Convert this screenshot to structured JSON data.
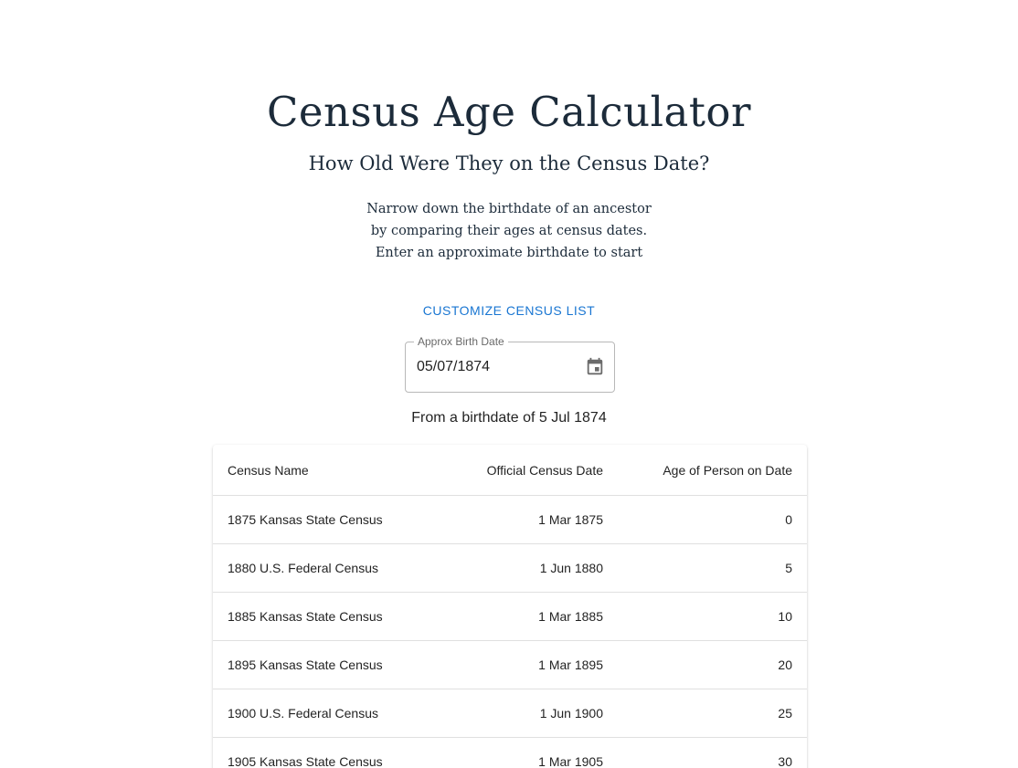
{
  "header": {
    "title": "Census Age Calculator",
    "subtitle": "How Old Were They on the Census Date?",
    "intro_lines": [
      "Narrow down the birthdate of an ancestor",
      "by comparing their ages at census dates.",
      "Enter an approximate birthdate to start"
    ]
  },
  "controls": {
    "customize_label": "CUSTOMIZE CENSUS LIST",
    "birth_date_label": "Approx Birth Date",
    "birth_date_value": "05/07/1874",
    "calendar_icon": "calendar-icon"
  },
  "summary_text": "From a birthdate of 5 Jul 1874",
  "table": {
    "headers": [
      "Census Name",
      "Official Census Date",
      "Age of Person on Date"
    ],
    "rows": [
      [
        "1875 Kansas State Census",
        "1 Mar 1875",
        "0"
      ],
      [
        "1880 U.S. Federal Census",
        "1 Jun 1880",
        "5"
      ],
      [
        "1885 Kansas State Census",
        "1 Mar 1885",
        "10"
      ],
      [
        "1895 Kansas State Census",
        "1 Mar 1895",
        "20"
      ],
      [
        "1900 U.S. Federal Census",
        "1 Jun 1900",
        "25"
      ],
      [
        "1905 Kansas State Census",
        "1 Mar 1905",
        "30"
      ]
    ]
  },
  "colors": {
    "heading": "#1c2b3a",
    "accent": "#1976d2"
  }
}
